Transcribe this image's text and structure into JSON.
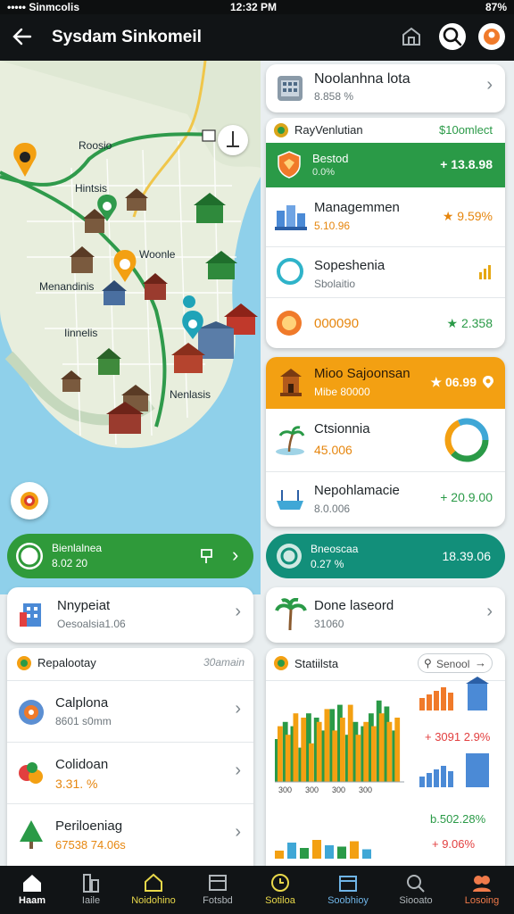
{
  "status_bar": {
    "carrier": "••••• Sinmcolis",
    "time": "12:32 PM",
    "battery": "87%"
  },
  "app_bar": {
    "title": "Sysdam Sinkomeil"
  },
  "map": {
    "labels": [
      "Roosio",
      "Hintsis",
      "Woonle",
      "Menandinis",
      "Iinnelis",
      "Nenlasis"
    ]
  },
  "top_card": {
    "title": "Noolanhna lota",
    "subtitle": "8.858 %"
  },
  "feature_card": {
    "header_title": "RayVenlutian",
    "header_value": "$10omlect",
    "green_row": {
      "title": "Bestod",
      "subtitle": "0.0%",
      "value": "+ 13.8.98"
    },
    "rows": [
      {
        "title": "Managemmen",
        "subtitle": "5.10.96",
        "value": "★ 9.59%"
      },
      {
        "title": "Sopeshenia",
        "subtitle": "Sbolaitio",
        "value": ""
      },
      {
        "title": "000090",
        "subtitle": "",
        "value": "★ 2.358"
      }
    ]
  },
  "orange_card": {
    "header_title": "Mioo Sajoonsan",
    "header_subtitle": "Mibe 80000",
    "header_value": "★ 06.99",
    "rows": [
      {
        "title": "Ctsionnia",
        "subtitle": "45.006"
      },
      {
        "title": "Nepohlamacie",
        "subtitle": "8.0.006",
        "value": "+ 20.9.00"
      }
    ]
  },
  "left_pill": {
    "title": "Bienlalnea",
    "subtitle": "8.02 20"
  },
  "right_pill": {
    "title": "Bneoscaa",
    "subtitle": "0.27 %",
    "value": "18.39.06"
  },
  "left_list": {
    "top_item": {
      "title": "Nnypeiat",
      "subtitle": "Oesoalsia1.06"
    },
    "section": {
      "title": "Repalootay",
      "value": "30amain"
    },
    "items": [
      {
        "title": "Calplona",
        "subtitle": "8601 s0mm"
      },
      {
        "title": "Colidoan",
        "subtitle": "3.31. %"
      },
      {
        "title": "Periloeniag",
        "subtitle": "67538 74.06s"
      }
    ]
  },
  "right_list": {
    "top_item": {
      "title": "Done laseord",
      "subtitle": "31060"
    },
    "stats": {
      "title": "Statiilsta",
      "search_label": "Senool",
      "value_1": "+ 3091 2.9%",
      "value_2": "b.502.28%",
      "value_3": "+ 9.06%",
      "axis_labels": [
        "300",
        "300",
        "300",
        "300"
      ]
    }
  },
  "chart_data": [
    {
      "type": "bar",
      "categories": [
        "",
        "",
        "",
        "",
        "",
        "",
        "",
        "",
        "",
        "",
        "",
        "",
        "",
        "",
        "",
        ""
      ],
      "series": [
        {
          "values": [
            50,
            70,
            65,
            40,
            80,
            75,
            60,
            85,
            90,
            55,
            70,
            65,
            80,
            95,
            88,
            60
          ]
        },
        {
          "values": [
            65,
            55,
            80,
            75,
            45,
            70,
            85,
            60,
            75,
            90,
            55,
            70,
            65,
            80,
            70,
            75
          ]
        }
      ]
    }
  ],
  "bottom_nav": [
    {
      "label": "Haam",
      "color": "#ffffff"
    },
    {
      "label": "Iaile",
      "color": "#b0b6ba"
    },
    {
      "label": "Noidohino",
      "color": "#e8d84a"
    },
    {
      "label": "Fotsbd",
      "color": "#b0b6ba"
    },
    {
      "label": "Sotiloa",
      "color": "#e8d84a"
    },
    {
      "label": "Soobhioy",
      "color": "#6fb4e6"
    },
    {
      "label": "Siooato",
      "color": "#b0b6ba"
    },
    {
      "label": "Losoing",
      "color": "#f07a4a"
    }
  ],
  "colors": {
    "green": "#2a9a47",
    "orange": "#f3a012",
    "teal": "#128f7a",
    "dark": "#111416"
  }
}
